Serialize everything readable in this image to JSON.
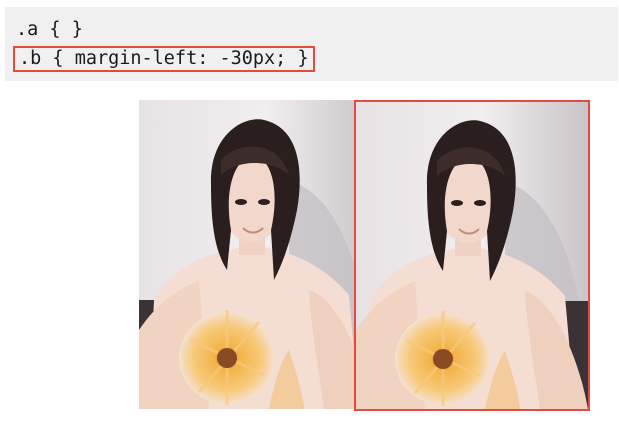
{
  "code": {
    "line_a": ".a { }",
    "line_b": ".b { margin-left: -30px; }"
  },
  "images": {
    "left": {
      "icon": "selfie-photo-icon"
    },
    "right": {
      "icon": "selfie-photo-icon"
    }
  },
  "colors": {
    "highlight": "#e54a3c",
    "code_bg": "#f0f0f0"
  }
}
